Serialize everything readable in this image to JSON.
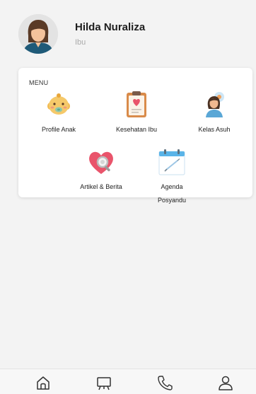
{
  "profile": {
    "name": "Hilda Nuraliza",
    "role": "Ibu",
    "avatar_icon": "woman-avatar-icon"
  },
  "menu": {
    "title": "MENU",
    "items": [
      {
        "label": "Profile Anak",
        "icon": "baby-face-icon"
      },
      {
        "label": "Kesehatan Ibu",
        "icon": "clipboard-heart-icon"
      },
      {
        "label": "Kelas Asuh",
        "icon": "mother-baby-icon"
      },
      {
        "label": "Artikel & Berita",
        "icon": "heart-magnifier-icon"
      },
      {
        "label": "Agenda\nPosyandu",
        "icon": "calendar-syringe-icon"
      }
    ]
  },
  "bottom_nav": [
    {
      "icon": "home-icon"
    },
    {
      "icon": "board-icon"
    },
    {
      "icon": "phone-icon"
    },
    {
      "icon": "user-icon"
    }
  ],
  "colors": {
    "background": "#f3f3f3",
    "card": "#ffffff",
    "accent_pink": "#e9546b",
    "accent_blue": "#5ab4e8",
    "baby_skin": "#f5c96a",
    "text_muted": "#a9a9a9"
  }
}
